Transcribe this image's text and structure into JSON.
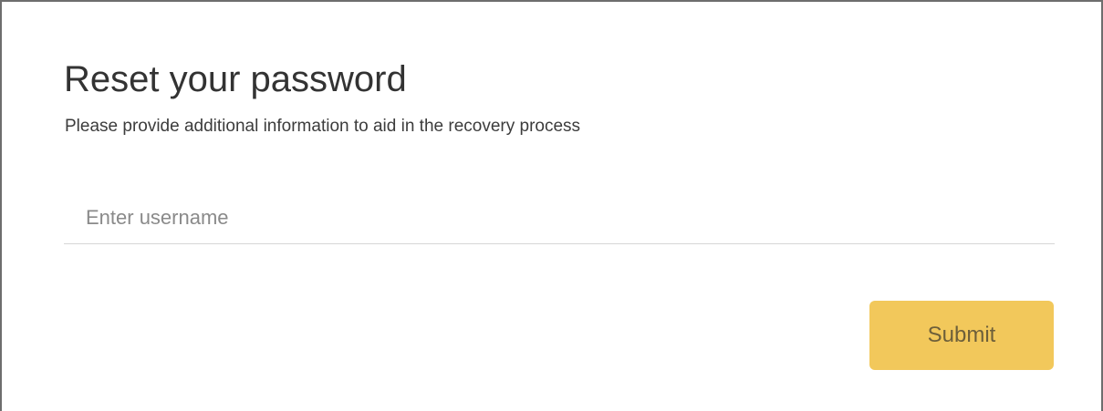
{
  "form": {
    "title": "Reset your password",
    "subtitle": "Please provide additional information to aid in the recovery process",
    "username_placeholder": "Enter username",
    "username_value": "",
    "submit_label": "Submit"
  },
  "colors": {
    "submit_background": "#f2c85b",
    "submit_text": "#6d5f3a",
    "title_text": "#333333",
    "input_underline": "#d6d6d6"
  }
}
